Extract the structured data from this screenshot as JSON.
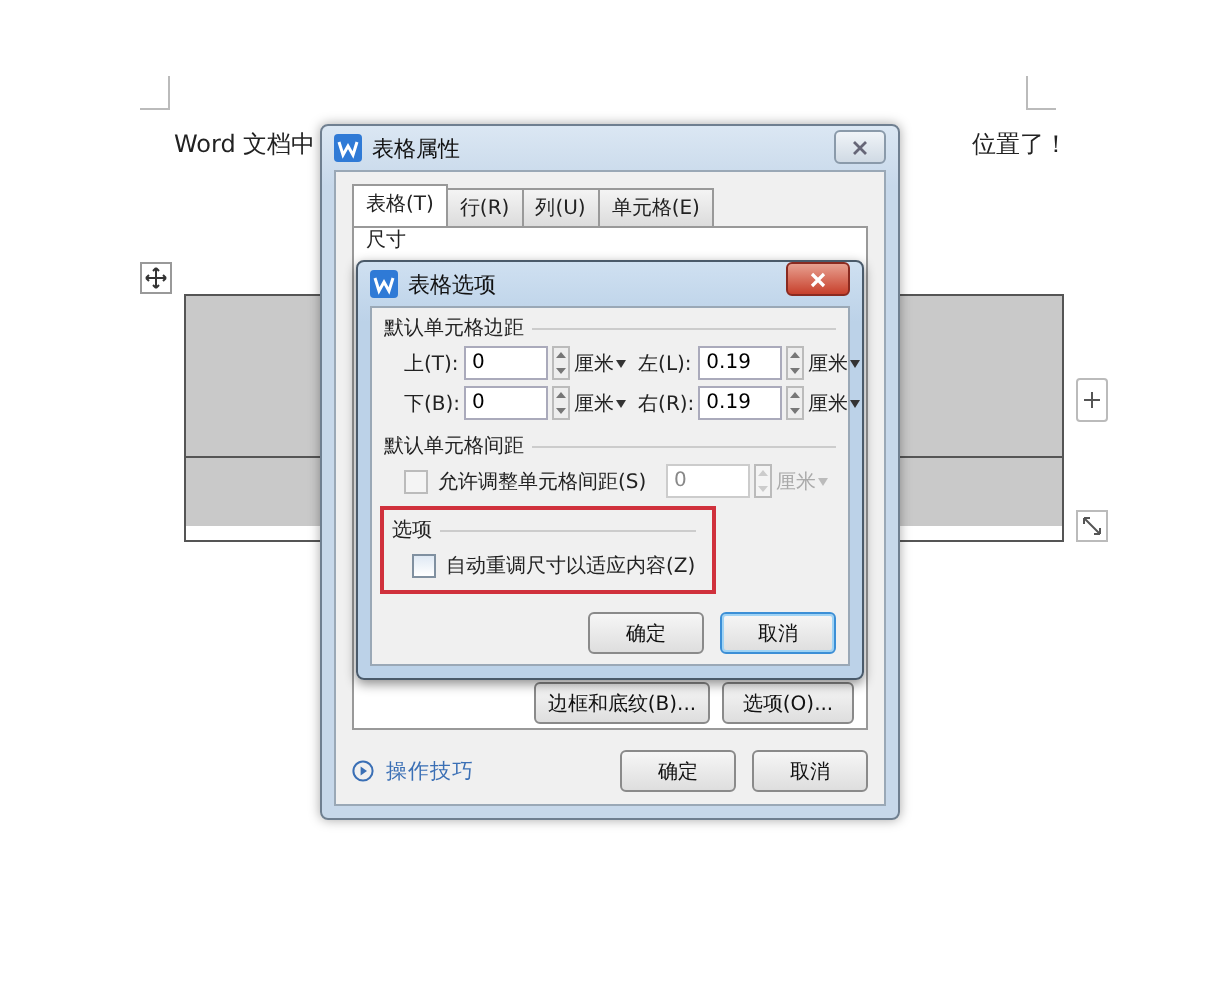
{
  "document": {
    "text_left": "Word 文档中",
    "text_right": "位置了！"
  },
  "table_properties": {
    "title": "表格属性",
    "tabs": [
      {
        "label": "表格(T)",
        "selected": true
      },
      {
        "label": "行(R)",
        "selected": false
      },
      {
        "label": "列(U)",
        "selected": false
      },
      {
        "label": "单元格(E)",
        "selected": false
      }
    ],
    "section": "尺寸",
    "buttons": [
      "边框和底纹(B)...",
      "选项(O)..."
    ],
    "tips_link": "操作技巧",
    "footer_buttons": [
      "确定",
      "取消"
    ]
  },
  "table_options": {
    "title": "表格选项",
    "margins_heading": "默认单元格边距",
    "margins": [
      {
        "label": "上(T):",
        "value": "0",
        "unit": "厘米"
      },
      {
        "label": "左(L):",
        "value": "0.19",
        "unit": "厘米"
      },
      {
        "label": "下(B):",
        "value": "0",
        "unit": "厘米"
      },
      {
        "label": "右(R):",
        "value": "0.19",
        "unit": "厘米"
      }
    ],
    "spacing_heading": "默认单元格间距",
    "spacing": {
      "label": "允许调整单元格间距(S)",
      "checked": false,
      "disabled": true,
      "value": "0",
      "unit": "厘米"
    },
    "options_heading": "选项",
    "auto_resize": {
      "label": "自动重调尺寸以适应内容(Z)",
      "checked": false,
      "highlighted": true
    },
    "buttons": [
      {
        "label": "确定",
        "focused": false
      },
      {
        "label": "取消",
        "focused": true
      }
    ]
  }
}
